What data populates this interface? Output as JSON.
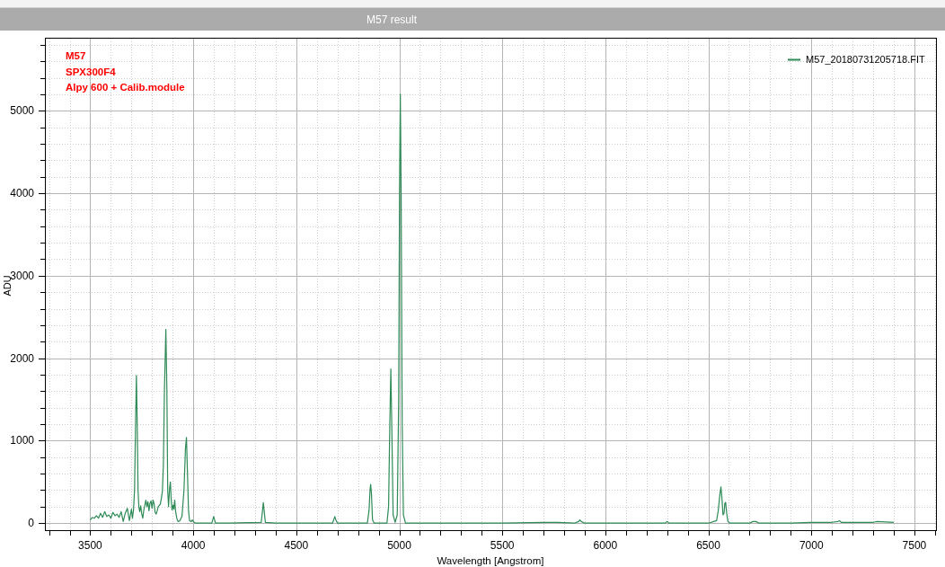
{
  "window": {
    "title": "M57 result"
  },
  "chart": {
    "chart_data": {
      "type": "line",
      "xlabel": "Wavelength [Angstrom]",
      "ylabel": "ADU",
      "grid": true,
      "x": [
        3500,
        3510,
        3520,
        3530,
        3540,
        3550,
        3560,
        3570,
        3580,
        3590,
        3600,
        3610,
        3620,
        3630,
        3640,
        3650,
        3660,
        3670,
        3680,
        3690,
        3700,
        3705,
        3710,
        3715,
        3720,
        3724,
        3728,
        3732,
        3736,
        3740,
        3745,
        3750,
        3755,
        3760,
        3770,
        3775,
        3780,
        3785,
        3790,
        3795,
        3800,
        3805,
        3810,
        3815,
        3820,
        3825,
        3830,
        3840,
        3845,
        3850,
        3855,
        3860,
        3867,
        3872,
        3876,
        3880,
        3885,
        3889,
        3893,
        3897,
        3902,
        3906,
        3910,
        3914,
        3920,
        3926,
        3935,
        3945,
        3955,
        3962,
        3967,
        3972,
        3977,
        3982,
        3990,
        3995,
        4000,
        4010,
        4050,
        4090,
        4099,
        4108,
        4150,
        4330,
        4336,
        4340,
        4344,
        4350,
        4400,
        4676,
        4683,
        4687,
        4692,
        4700,
        4845,
        4853,
        4858,
        4861,
        4865,
        4870,
        4878,
        4940,
        4948,
        4954,
        4959,
        4964,
        4970,
        4980,
        4990,
        4997,
        5001,
        5005,
        5009,
        5014,
        5020,
        5030,
        5300,
        5500,
        5700,
        5770,
        5850,
        5870,
        5876,
        5883,
        5900,
        6100,
        6290,
        6300,
        6310,
        6500,
        6540,
        6548,
        6556,
        6561,
        6566,
        6571,
        6576,
        6580,
        6584,
        6589,
        6595,
        6605,
        6700,
        6716,
        6731,
        6745,
        6900,
        7000,
        7100,
        7130,
        7136,
        7145,
        7200,
        7300,
        7320,
        7400
      ],
      "series": [
        {
          "name": "M57_20180731205718.FIT",
          "color": "#2e8b57",
          "values": [
            40,
            70,
            60,
            90,
            60,
            120,
            70,
            140,
            80,
            100,
            60,
            130,
            90,
            110,
            70,
            140,
            20,
            120,
            180,
            30,
            170,
            60,
            160,
            400,
            1200,
            1790,
            1200,
            400,
            200,
            140,
            210,
            110,
            60,
            160,
            280,
            200,
            260,
            150,
            240,
            270,
            180,
            280,
            230,
            130,
            110,
            150,
            200,
            230,
            300,
            380,
            700,
            1600,
            2350,
            1600,
            400,
            200,
            420,
            500,
            280,
            160,
            220,
            170,
            280,
            150,
            60,
            20,
            30,
            80,
            400,
            900,
            1040,
            600,
            150,
            30,
            20,
            40,
            20,
            0,
            0,
            0,
            80,
            0,
            0,
            10,
            150,
            250,
            150,
            10,
            0,
            0,
            50,
            80,
            40,
            0,
            0,
            150,
            400,
            470,
            350,
            40,
            0,
            0,
            200,
            1200,
            1870,
            1100,
            100,
            10,
            100,
            1500,
            4000,
            5200,
            4000,
            1200,
            100,
            0,
            0,
            0,
            10,
            10,
            0,
            20,
            40,
            20,
            0,
            0,
            0,
            20,
            0,
            0,
            30,
            150,
            350,
            440,
            300,
            100,
            120,
            240,
            250,
            120,
            20,
            0,
            0,
            20,
            20,
            0,
            0,
            10,
            10,
            20,
            30,
            10,
            10,
            10,
            20,
            10
          ]
        }
      ],
      "xlim": [
        3280,
        7605
      ],
      "ylim": [
        -85,
        5885
      ],
      "xticks": [
        3500,
        4000,
        4500,
        5000,
        5500,
        6000,
        6500,
        7000,
        7500
      ],
      "yticks": [
        0,
        1000,
        2000,
        3000,
        4000,
        5000
      ],
      "annotations": [
        "M57",
        "SPX300F4",
        "Alpy 600 + Calib.module"
      ]
    }
  }
}
